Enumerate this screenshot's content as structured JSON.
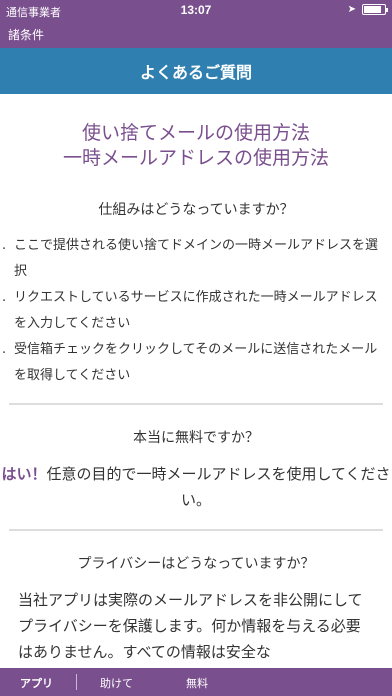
{
  "status": {
    "carrier": "通信事業者",
    "time": "13:07",
    "battery_level": 0.85
  },
  "topbar": {
    "back_label": "諸条件"
  },
  "header": {
    "title": "よくあるご質問"
  },
  "main": {
    "title_line1": "使い捨てメールの使用方法",
    "title_line2": "一時メールアドレスの使用方法",
    "faq1": {
      "question": "仕組みはどうなっていますか？",
      "steps": [
        "ここで提供される使い捨てドメインの一時メールアドレスを選択",
        "リクエストしているサービスに作成された一時メールアドレスを入力してください",
        "受信箱チェックをクリックしてそのメールに送信されたメールを取得してください"
      ]
    },
    "faq2": {
      "question": "本当に無料ですか？",
      "answer_bold": "はい！",
      "answer_rest": "任意の目的で一時メールアドレスを使用してください。"
    },
    "faq3": {
      "question": "プライバシーはどうなっていますか？",
      "answer": "当社アプリは実際のメールアドレスを非公開にしてプライバシーを保護します。何か情報を与える必要はありません。すべての情報は安全な"
    }
  },
  "tabs": [
    {
      "label": "アプリ"
    },
    {
      "label": "助けて"
    },
    {
      "label": "無料"
    }
  ],
  "colors": {
    "purple": "#7a4f8e",
    "blue": "#2f7fb0"
  }
}
